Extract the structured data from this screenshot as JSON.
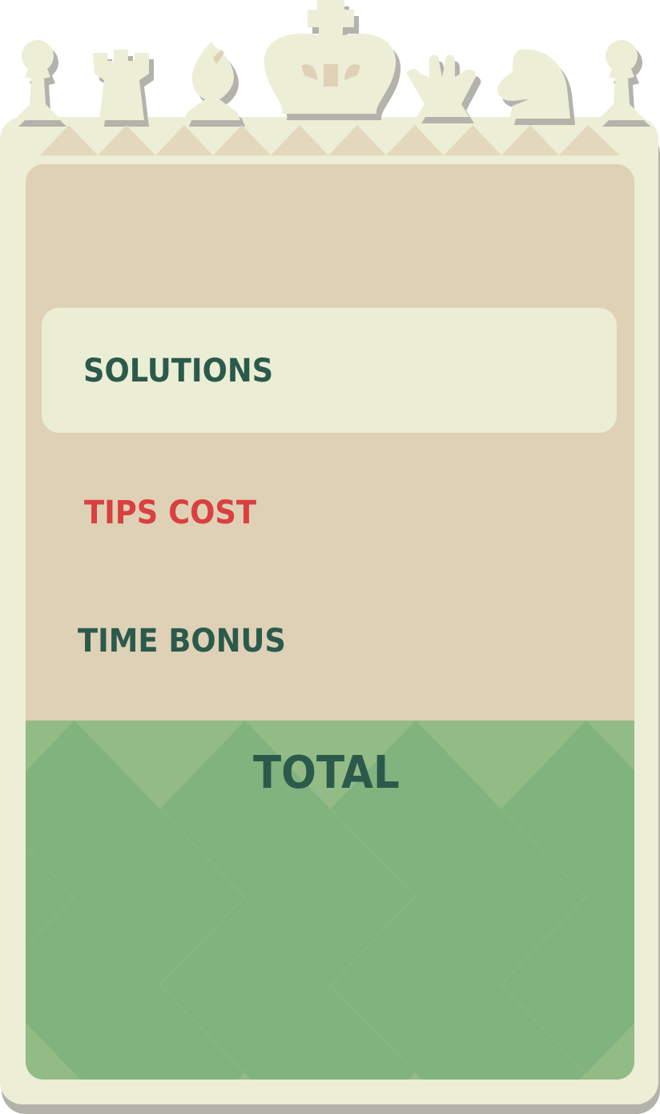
{
  "score_card": {
    "solutions_label": "SOLUTIONS",
    "tips_cost_label": "TIPS COST",
    "time_bonus_label": "TIME BONUS",
    "total_label": "TOTAL"
  },
  "decorations": {
    "crown_pieces": [
      "pawn-icon",
      "rook-icon",
      "bishop-icon",
      "king-icon",
      "queen-icon",
      "knight-icon",
      "pawn-icon"
    ]
  },
  "colors": {
    "frame": "#eceed6",
    "panel": "#dfd1b6",
    "highlight_row": "#ecedd5",
    "green_light": "#93bb85",
    "green_dark": "#81b37f",
    "text_dark_green": "#2b5a4c",
    "text_red": "#d9403f"
  }
}
